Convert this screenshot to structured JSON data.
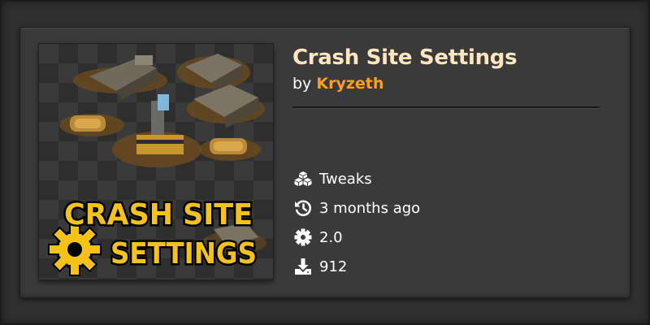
{
  "mod": {
    "title": "Crash Site Settings",
    "by_label": "by",
    "author": "Kryzeth",
    "thumbnail_text": [
      "CRASH SITE",
      "SETTINGS"
    ]
  },
  "info": {
    "category": {
      "icon": "cubes-icon",
      "text": "Tweaks"
    },
    "updated": {
      "icon": "history-icon",
      "text": "3 months ago"
    },
    "version": {
      "icon": "gear-icon",
      "text": "2.0"
    },
    "downloads": {
      "icon": "download-icon",
      "text": "912"
    }
  },
  "colors": {
    "title": "#ffe6c0",
    "author": "#ff9f1c",
    "card_bg": "#3a3a3a",
    "thumb_text": "#f5c21b"
  }
}
